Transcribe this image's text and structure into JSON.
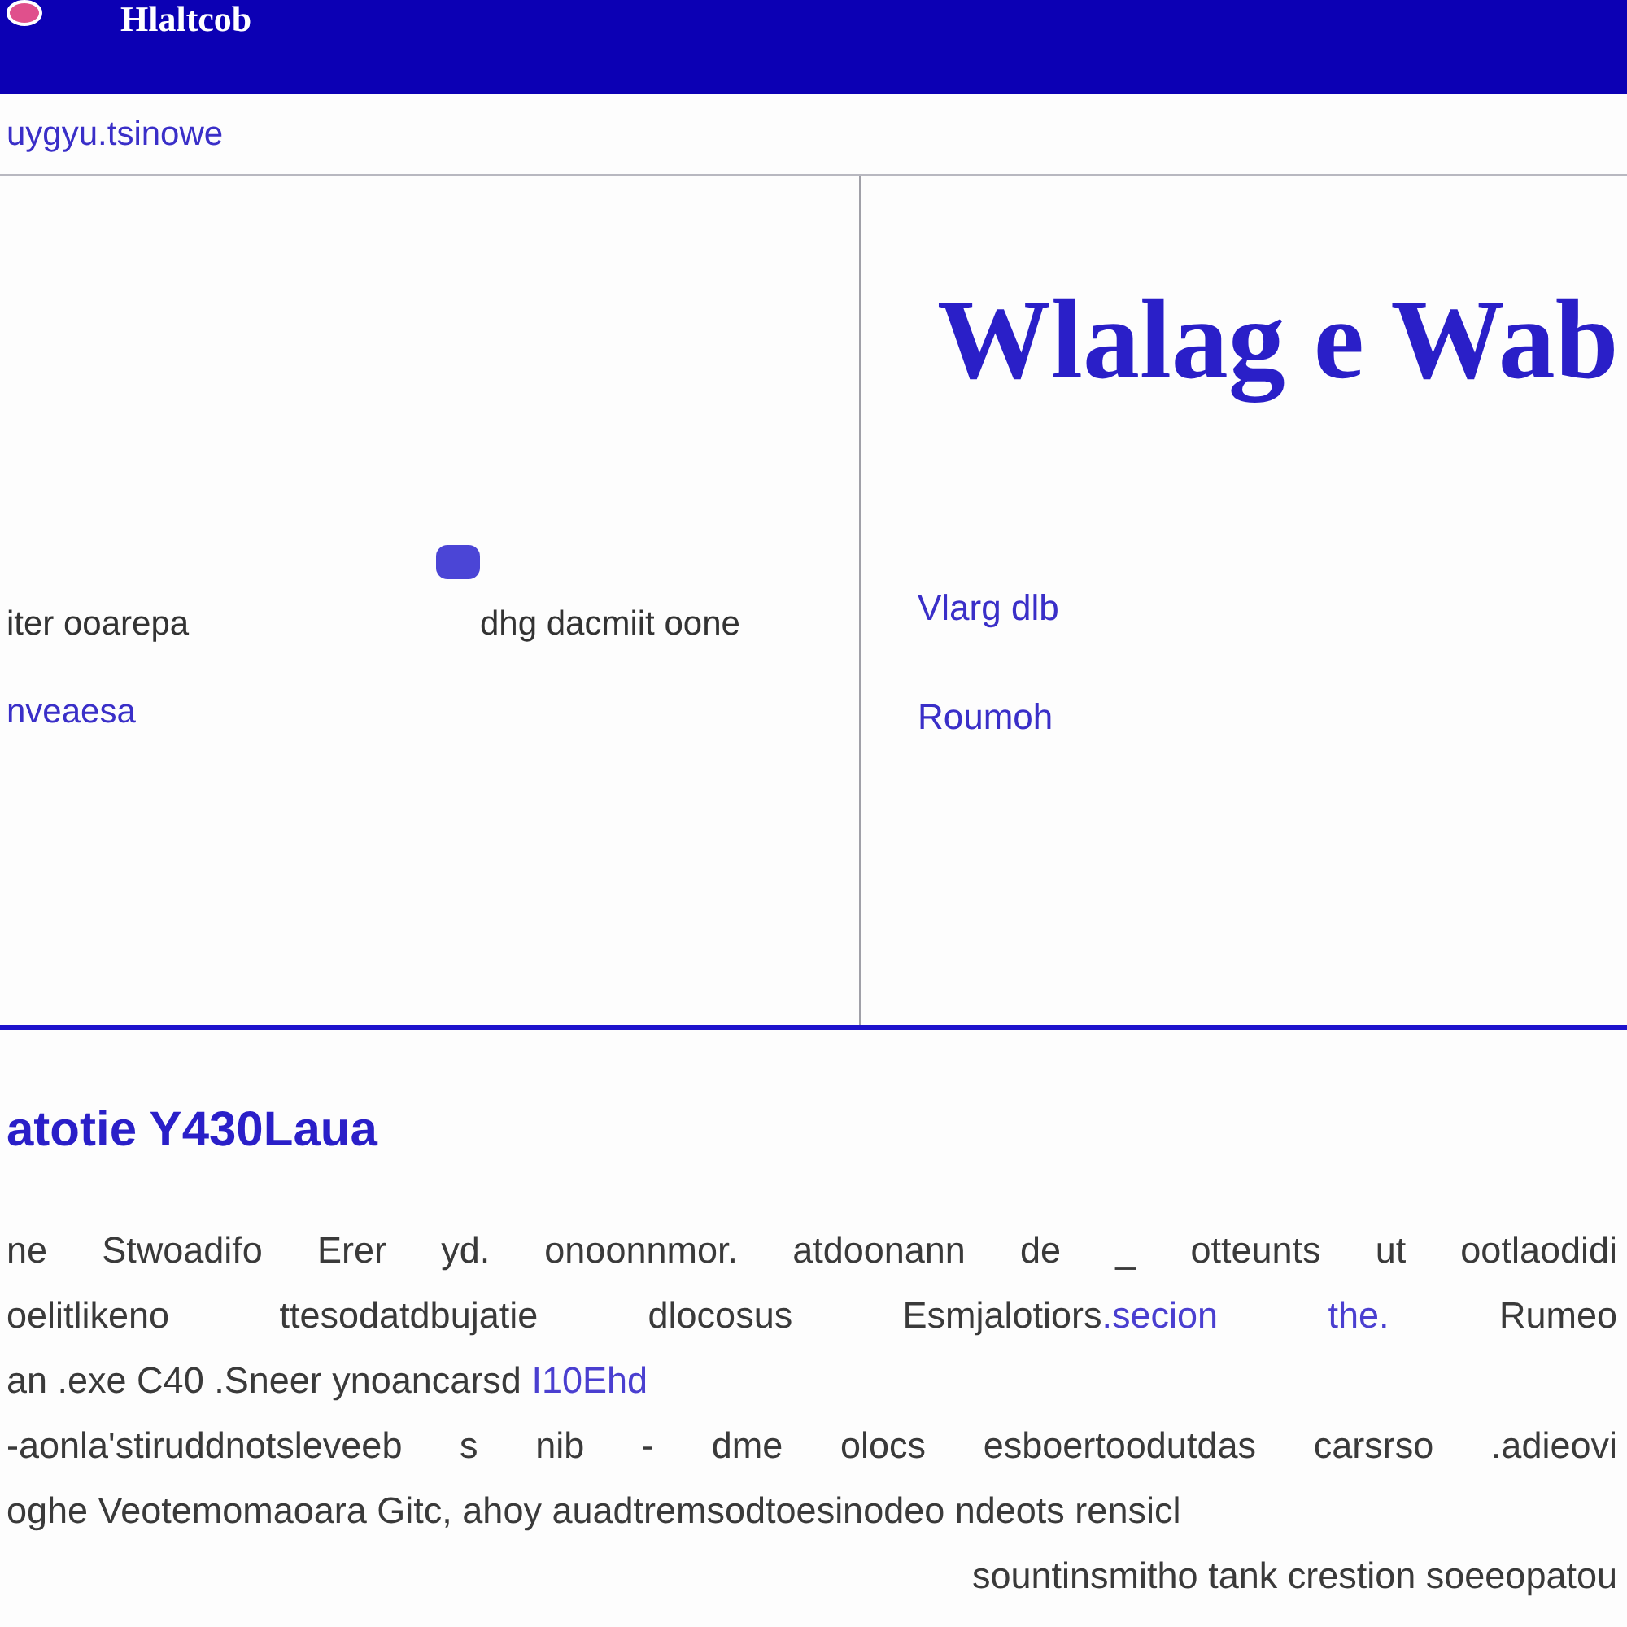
{
  "header": {
    "title": "Hlaltcob"
  },
  "subheader": {
    "link": "uygyu.tsinowe"
  },
  "left_panel": {
    "items": [
      {
        "kind": "text",
        "text": "iter ooarepa"
      },
      {
        "kind": "text",
        "text": "dhg dacmiit oone"
      },
      {
        "kind": "link",
        "text": "nveaesa"
      }
    ]
  },
  "right_panel": {
    "heading": "Wlalag e Wab",
    "links": [
      "Vlarg dlb",
      "Roumoh"
    ]
  },
  "article": {
    "heading": "atotie Y430Laua",
    "paragraphs": [
      {
        "lines": [
          [
            {
              "kind": "text",
              "text": "ne Stwoadifo Erer yd. onoonnmor. atdoonann de _ otteunts ut ootlaodidi"
            }
          ],
          [
            {
              "kind": "text",
              "text": "oelitlikeno ttesodatdbujatie dlocosus Esmjalotiors"
            },
            {
              "kind": "link",
              "text": ".secion the."
            },
            {
              "kind": "text",
              "text": " Rumeo"
            }
          ],
          [
            {
              "kind": "text",
              "text": "an .exe C40 .Sneer ynoancarsd "
            },
            {
              "kind": "link",
              "text": "I10Ehd"
            }
          ]
        ]
      },
      {
        "lines": [
          [
            {
              "kind": "text",
              "text": "-aonla'stiruddnotsleveeb s nib - dme olocs esboertoodutdas carsrso .adieovi"
            }
          ],
          [
            {
              "kind": "text",
              "text": "oghe Veotemomaoara Gitc, ahoy auadtremsodtoesinodeo ndeots rensicl"
            }
          ]
        ]
      }
    ],
    "closing_line": "sountinsmitho tank crestion soeeopatou"
  }
}
